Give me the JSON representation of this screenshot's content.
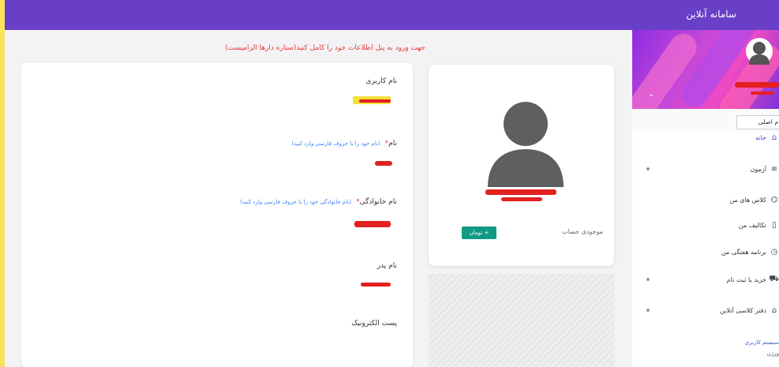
{
  "app": {
    "title": "سامانه آنلاین"
  },
  "main": {
    "hint": "جهت ورود به پنل اطلاعات خود را کامل کنید(ستاره دارها الزامیست)",
    "form": {
      "username_label": "نام کاربری",
      "first_name_label": "نام",
      "first_name_hint": "(نام خود را با حروف فارسی وارد کنید)",
      "last_name_label": "نام خانوادگی",
      "last_name_hint": "(نام خانوادگی خود را با حروف فارسی وارد کنید)",
      "father_name_label": "نام پدر",
      "email_label": "پست الکترونیک",
      "required_mark": "*"
    },
    "profile": {
      "balance_label": "موجودی حساب",
      "topup_label": "+ تومان"
    }
  },
  "sidebar": {
    "name_field_value": "نام اصلی",
    "items": [
      {
        "label": "خانه",
        "icon": "home-icon",
        "active": true,
        "expandable": false
      },
      {
        "label": "آزمون",
        "icon": "list-icon",
        "active": false,
        "expandable": true
      },
      {
        "label": "کلاس های من",
        "icon": "institution-icon",
        "active": false,
        "expandable": false
      },
      {
        "label": "تکالیف من",
        "icon": "clipboard-icon",
        "active": false,
        "expandable": false
      },
      {
        "label": "برنامه هفتگی من",
        "icon": "clock-icon",
        "active": false,
        "expandable": false
      },
      {
        "label": "خرید یا ثبت نام",
        "icon": "cart-icon",
        "active": false,
        "expandable": true
      },
      {
        "label": "دفتر کلاسی آنلاین",
        "icon": "graduation-cap-icon",
        "active": false,
        "expandable": true
      }
    ],
    "footer_line1": "سیستم کاربری",
    "footer_line2": "ورژن"
  },
  "colors": {
    "topbar": "#6a3fc8",
    "accent": "#5b3ccf",
    "hint_red": "#e53935",
    "button_teal": "#119a83",
    "stripe_yellow": "#f7e45a"
  }
}
